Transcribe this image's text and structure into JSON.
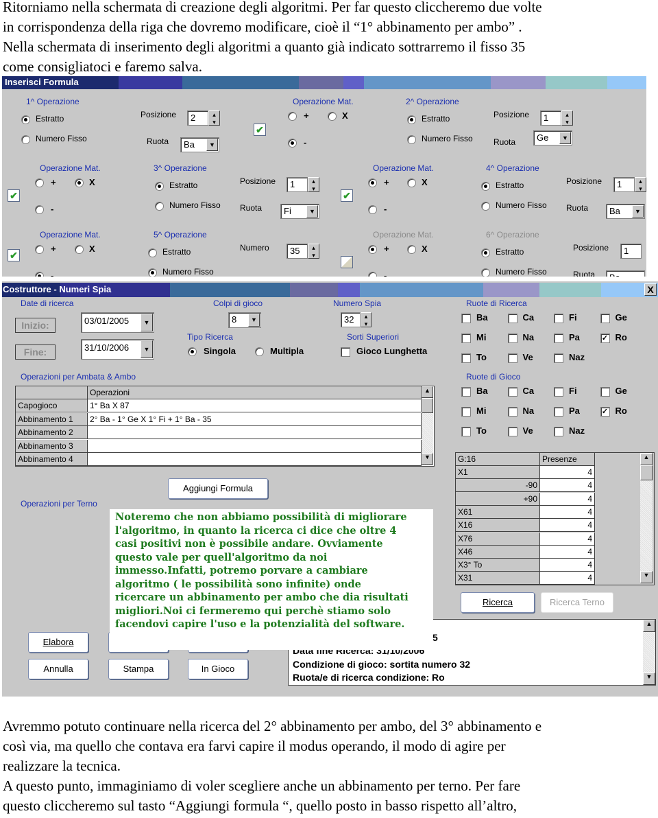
{
  "intro": [
    "Ritorniamo nella schermata di creazione degli algoritmi. Per far questo cliccheremo due volte",
    "in corrispondenza della riga che dovremo modificare, cioè il “1° abbinamento per ambo” .",
    "Nella schermata di inserimento degli algoritmi a quanto già indicato sottrarremo il fisso 35",
    "come consigliatoci e faremo salva."
  ],
  "formula": {
    "title": "Inserisci Formula",
    "labels": {
      "posizione": "Posizione",
      "ruota": "Ruota",
      "numero": "Numero",
      "estratto": "Estratto",
      "numero_fisso": "Numero Fisso",
      "op_mat": "Operazione Mat.",
      "plus": "+",
      "times": "X",
      "minus": "-"
    },
    "op1": {
      "title": "1^ Operazione",
      "mode": "Estratto",
      "posizione": "2",
      "ruota": "Ba"
    },
    "mat1": {
      "enabled": true,
      "value": "-"
    },
    "op2": {
      "title": "2^ Operazione",
      "mode": "Estratto",
      "posizione": "1",
      "ruota": "Ge"
    },
    "mat2": {
      "enabled": true,
      "value": "X"
    },
    "op3": {
      "title": "3^ Operazione",
      "mode": "Estratto",
      "posizione": "1",
      "ruota": "Fi"
    },
    "mat3": {
      "enabled": true,
      "value": "+"
    },
    "op4": {
      "title": "4^ Operazione",
      "mode": "Estratto",
      "posizione": "1",
      "ruota": "Ba"
    },
    "mat4": {
      "enabled": true,
      "value": "-"
    },
    "op5": {
      "title": "5^ Operazione",
      "mode": "Numero Fisso",
      "numero": "35"
    },
    "mat5": {
      "enabled": false,
      "value": "+"
    },
    "op6": {
      "title": "6^ Operazione",
      "mode": "Estratto",
      "posizione": "1",
      "ruota": "Ba"
    }
  },
  "costruttore": {
    "title": "Costruttore - Numeri Spia",
    "close": "X",
    "date_label": "Date di ricerca",
    "inizio": "Inizio:",
    "fine": "Fine:",
    "date_start": "03/01/2005",
    "date_end": "31/10/2006",
    "colpi_label": "Colpi di gioco",
    "colpi": "8",
    "spia_label": "Numero Spia",
    "spia": "32",
    "tipo_label": "Tipo Ricerca",
    "singola": "Singola",
    "multipla": "Multipla",
    "tipo": "Singola",
    "sorti_label": "Sorti Superiori",
    "lunghetta": "Gioco Lunghetta",
    "lunghetta_checked": false,
    "ambo_label": "Operazioni per Ambata & Ambo",
    "ops_header": "Operazioni",
    "ops_rows": [
      [
        "Capogioco",
        "1° Ba X 87"
      ],
      [
        "Abbinamento 1",
        "2° Ba - 1° Ge X 1° Fi + 1° Ba - 35"
      ],
      [
        "Abbinamento 2",
        ""
      ],
      [
        "Abbinamento 3",
        ""
      ],
      [
        "Abbinamento 4",
        ""
      ]
    ],
    "aggiungi": "Aggiungi Formula",
    "terno_label": "Operazioni per Terno",
    "ruote_ricerca_label": "Ruote di Ricerca",
    "ruote_gioco_label": "Ruote di Gioco",
    "ruote": [
      "Ba",
      "Ca",
      "Fi",
      "Ge",
      "Mi",
      "Na",
      "Pa",
      "Ro",
      "To",
      "Ve",
      "Naz"
    ],
    "ruote_ricerca_checked": [
      "Ro"
    ],
    "ruote_gioco_checked": [
      "Ro"
    ],
    "res_header": [
      "G:16",
      "Presenze"
    ],
    "res_rows": [
      [
        "X1",
        "4"
      ],
      [
        "-90",
        "4"
      ],
      [
        "+90",
        "4"
      ],
      [
        "X61",
        "4"
      ],
      [
        "X16",
        "4"
      ],
      [
        "X76",
        "4"
      ],
      [
        "X46",
        "4"
      ],
      [
        "X3° To",
        "4"
      ],
      [
        "X31",
        "4"
      ]
    ],
    "ricerca": "Ricerca",
    "ricerca_terno": "Ricerca Terno",
    "output": [
      "5",
      "Data fine Ricerca: 31/10/2006",
      "Condizione di gioco: sortita numero 32",
      "Ruota/e di ricerca condizione:  Ro"
    ],
    "buttons": {
      "elabora": "Elabora",
      "annulla": "Annulla",
      "stampa": "Stampa",
      "in_gioco": "In Gioco"
    }
  },
  "note": [
    "Noteremo che non abbiamo possibilità di migliorare",
    "l'algoritmo, in quanto la ricerca ci dice che oltre 4",
    "casi positivi non è possibile andare. Ovviamente",
    "questo vale per quell'algoritmo da noi",
    "immesso.Infatti, potremo porvare a cambiare",
    "algoritmo ( le possibilità sono infinite) onde",
    "ricercare un abbinamento per ambo che dia risultati",
    "migliori.Noi ci fermeremo qui perchè stiamo solo",
    "facendovi capire l'uso e la potenzialità del software."
  ],
  "outro": [
    "Avremmo potuto continuare nella ricerca del 2° abbinamento per ambo, del 3° abbinamento e",
    "così via, ma quello che contava era farvi capire il modus operando, il modo di agire per",
    "realizzare la tecnica.",
    "A questo punto, immaginiamo di voler scegliere anche un abbinamento per terno. Per fare",
    "questo cliccheremo sul tasto “Aggiungi formula “, quello posto in basso rispetto all’altro,"
  ]
}
